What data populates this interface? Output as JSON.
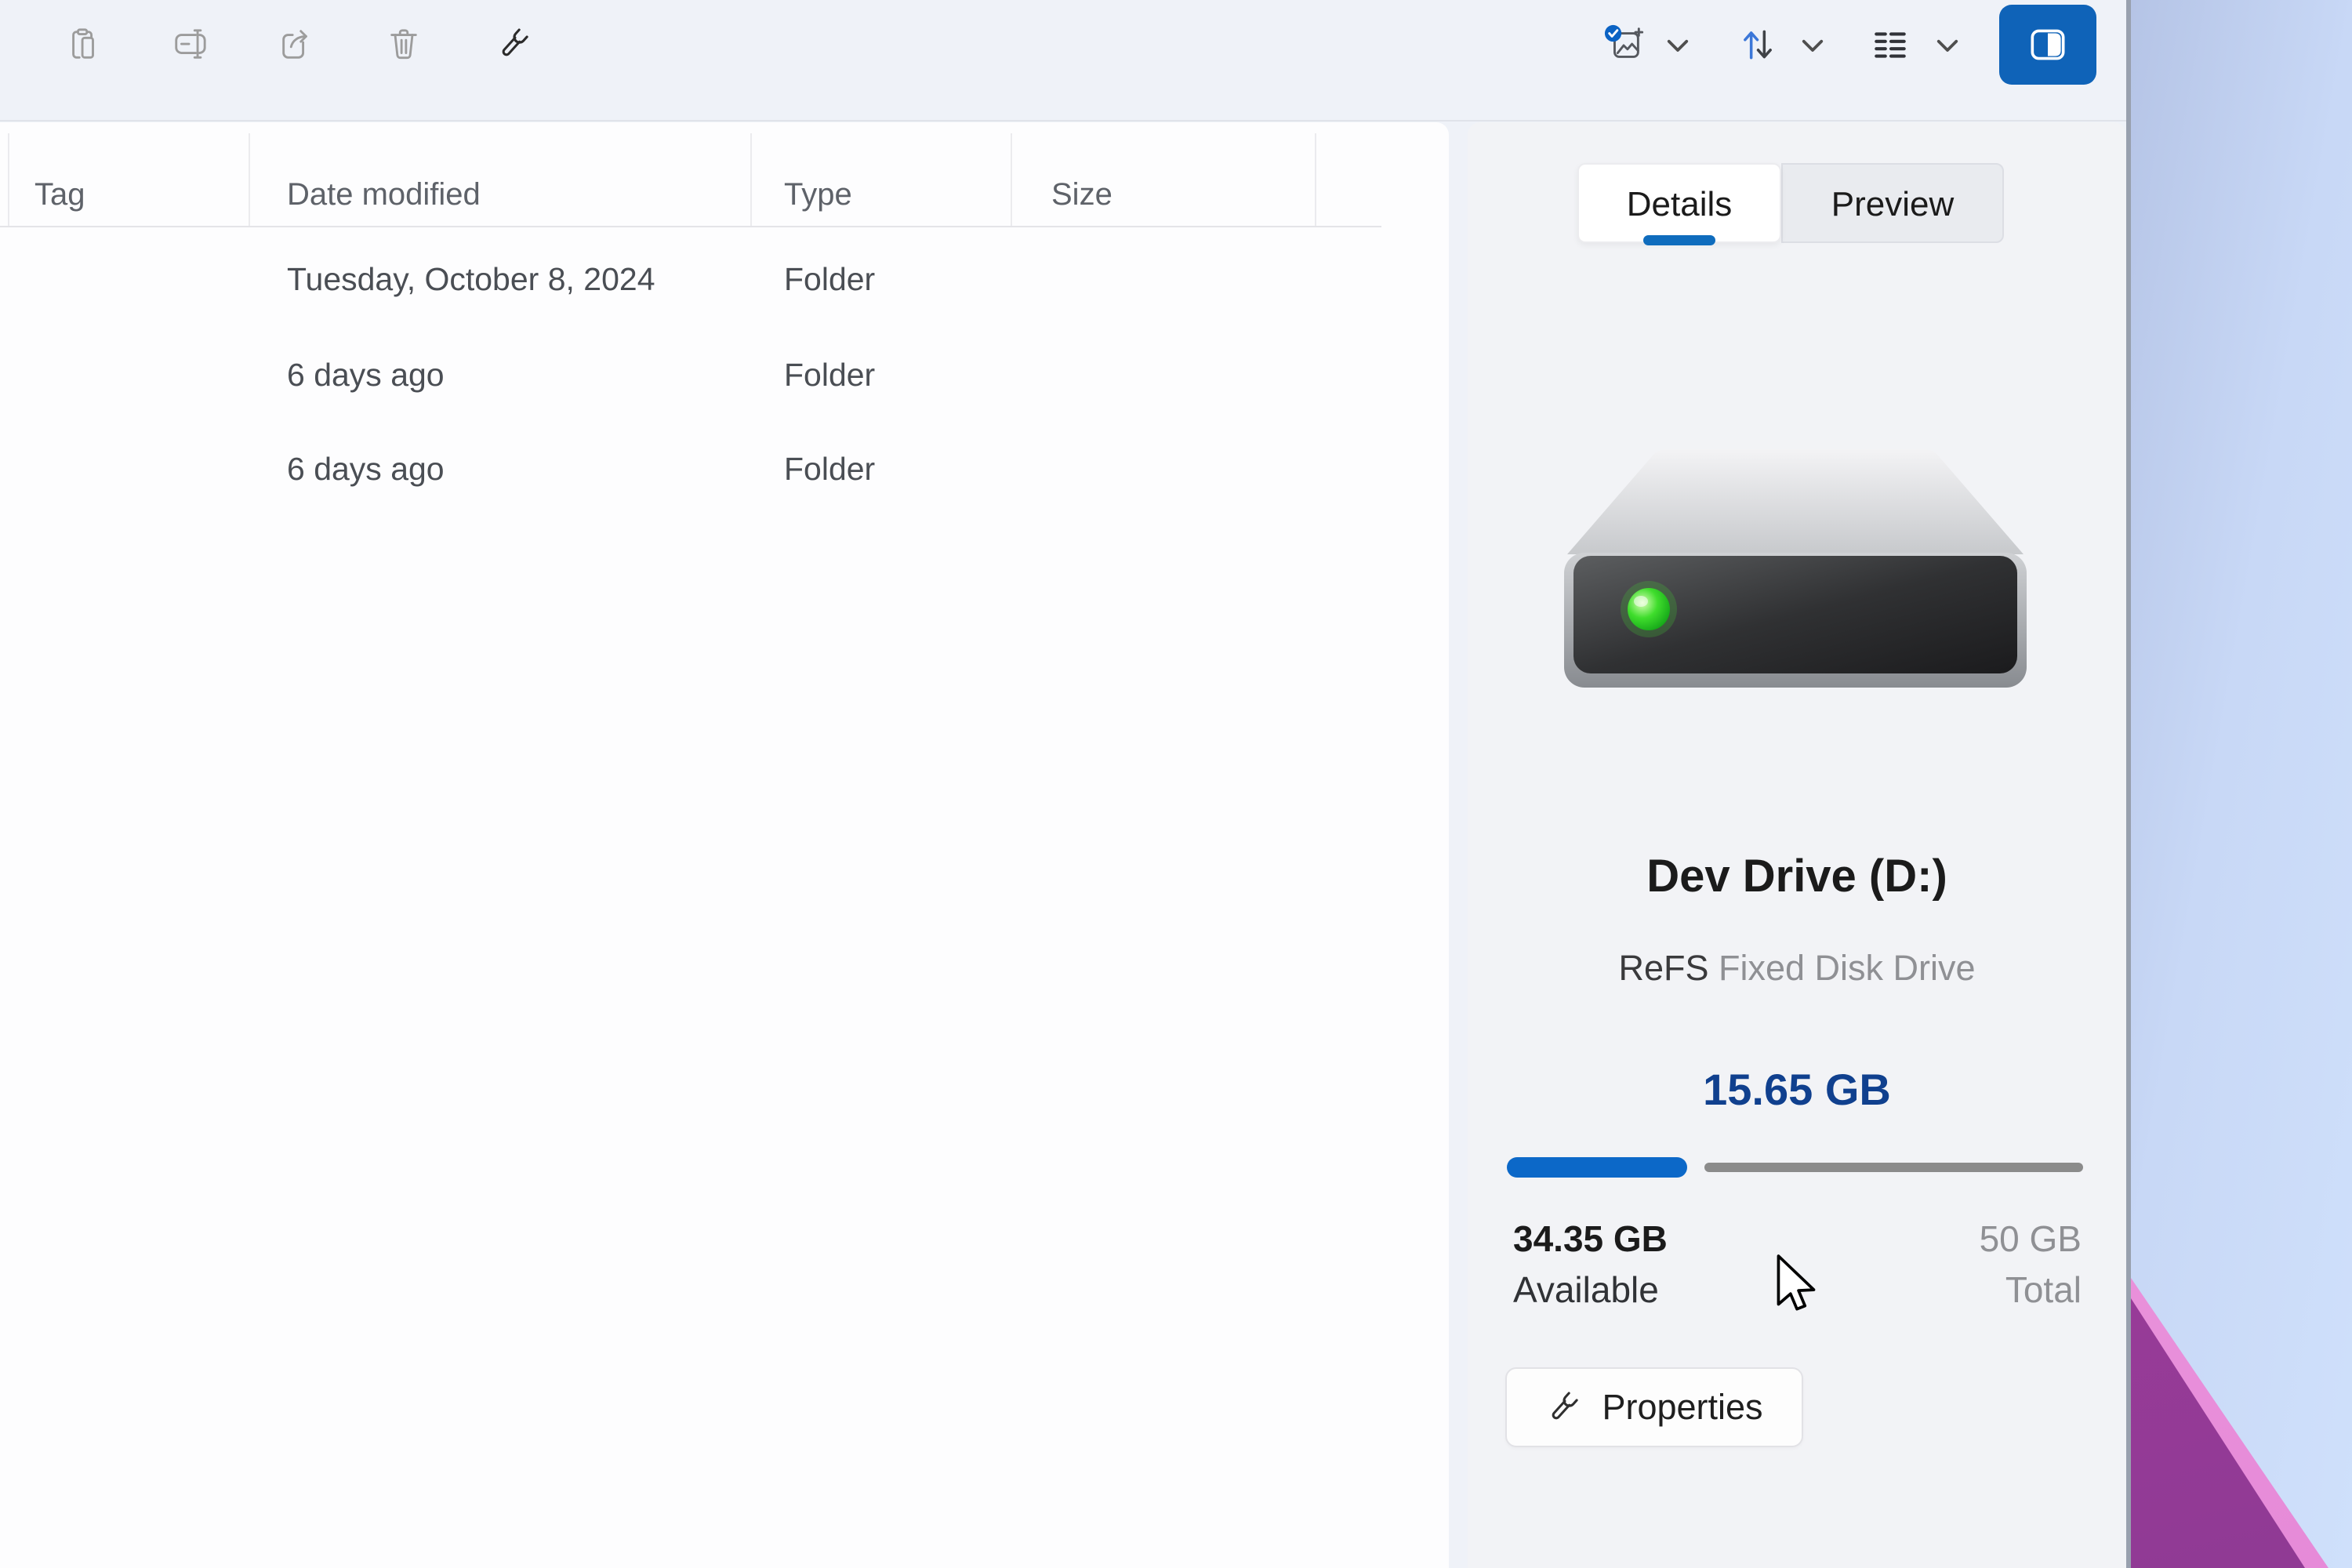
{
  "toolbar": {
    "left_icons": [
      {
        "name": "paste",
        "icon": "clipboard-icon",
        "enabled": false
      },
      {
        "name": "rename",
        "icon": "rename-icon",
        "enabled": false
      },
      {
        "name": "share",
        "icon": "share-icon",
        "enabled": false
      },
      {
        "name": "delete",
        "icon": "trash-icon",
        "enabled": false
      },
      {
        "name": "properties",
        "icon": "wrench-icon",
        "enabled": true
      }
    ],
    "right_icons": [
      {
        "name": "select",
        "icon": "image-check-icon",
        "has_dropdown": true
      },
      {
        "name": "sort",
        "icon": "sort-arrows-icon",
        "has_dropdown": true
      },
      {
        "name": "view",
        "icon": "list-view-icon",
        "has_dropdown": true
      },
      {
        "name": "toggle-details-pane",
        "icon": "details-pane-icon",
        "active": true
      }
    ]
  },
  "file_list": {
    "columns": [
      {
        "label": "Tag"
      },
      {
        "label": "Date modified"
      },
      {
        "label": "Type"
      },
      {
        "label": "Size"
      }
    ],
    "rows": [
      {
        "tag": "",
        "date_modified": "Tuesday, October 8, 2024",
        "type": "Folder",
        "size": ""
      },
      {
        "tag": "",
        "date_modified": "6 days ago",
        "type": "Folder",
        "size": ""
      },
      {
        "tag": "",
        "date_modified": "6 days ago",
        "type": "Folder",
        "size": ""
      }
    ]
  },
  "details_pane": {
    "tabs": [
      {
        "label": "Details",
        "active": true
      },
      {
        "label": "Preview",
        "active": false
      }
    ],
    "drive": {
      "name": "Dev Drive (D:)",
      "filesystem": "ReFS",
      "drive_type": "Fixed Disk Drive",
      "used": "15.65 GB",
      "used_fraction": 0.313,
      "available": "34.35 GB",
      "available_label": "Available",
      "total": "50 GB",
      "total_label": "Total"
    },
    "properties_button": {
      "label": "Properties",
      "icon": "wrench-icon"
    }
  },
  "colors": {
    "accent_blue": "#0f63b8",
    "tab_pill_blue": "#0f6cbd",
    "capacity_text_blue": "#10408e",
    "bar_fill_blue": "#0c68c8",
    "bar_track_gray": "#8b8b8b",
    "led_green": "#2ec02a",
    "wallpaper_purple": "#a23c9c",
    "wallpaper_blue": "#c8d8f6"
  }
}
